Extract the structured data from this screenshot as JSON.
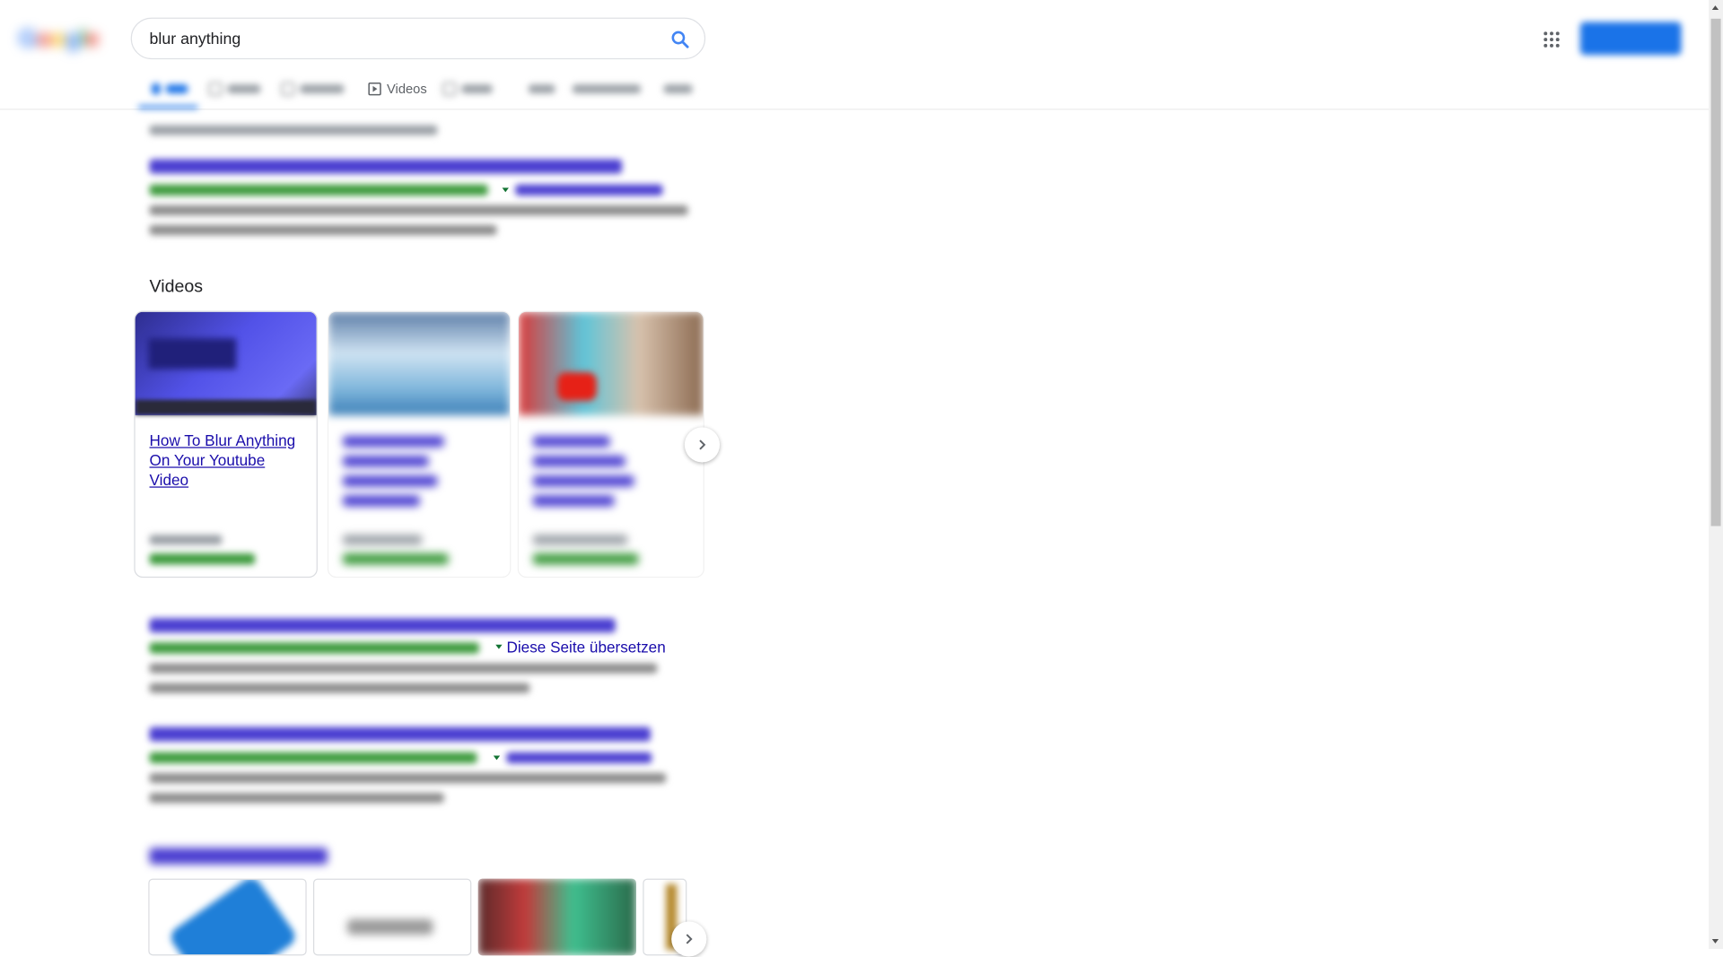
{
  "search": {
    "query": "blur anything",
    "icon": "search-icon"
  },
  "header": {
    "logo_letters": [
      "G",
      "o",
      "o",
      "g",
      "l",
      "e"
    ],
    "apps_icon": "apps-grid-icon",
    "colors": {
      "accent": "#1a73e8",
      "link": "#1a0dab",
      "url_green": "#137333"
    }
  },
  "tabs": {
    "videos_label": "Videos"
  },
  "videos": {
    "heading": "Videos",
    "cards": [
      {
        "title": "How To Blur Anything On Your Youtube Video"
      }
    ]
  },
  "results": {
    "translate_label": "Diese Seite übersetzen"
  }
}
